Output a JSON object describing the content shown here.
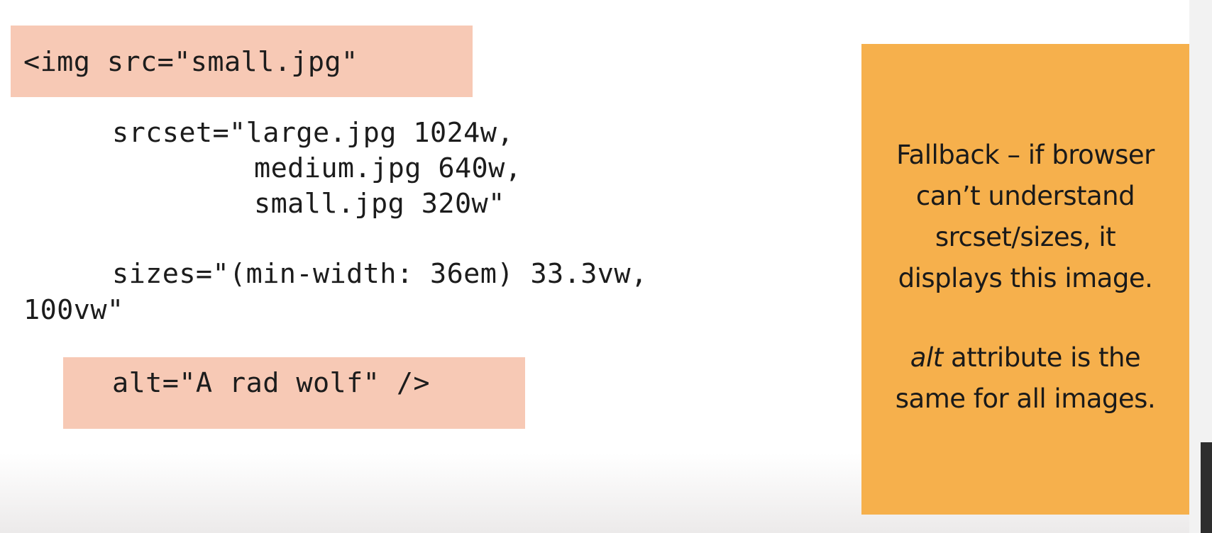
{
  "code": {
    "line1": "<img src=\"small.jpg\"",
    "srcset": {
      "line1": "srcset=\"large.jpg 1024w,",
      "line2": "medium.jpg 640w,",
      "line3": "small.jpg 320w\""
    },
    "sizes": {
      "line1": "sizes=\"(min-width: 36em) 33.3vw,",
      "line2": "100vw\""
    },
    "alt_line": "alt=\"A rad wolf\" />"
  },
  "note": {
    "paragraph1": [
      "Fallback – if browser",
      "can’t understand",
      "srcset/sizes, it",
      "displays this image."
    ],
    "paragraph2": {
      "line1_italic": "alt",
      "line1_rest": " attribute is the",
      "line2": "same for all images."
    }
  },
  "colors": {
    "highlight": "#f7c9b5",
    "note_background": "#f6b04c",
    "text": "#1c1c1c"
  }
}
